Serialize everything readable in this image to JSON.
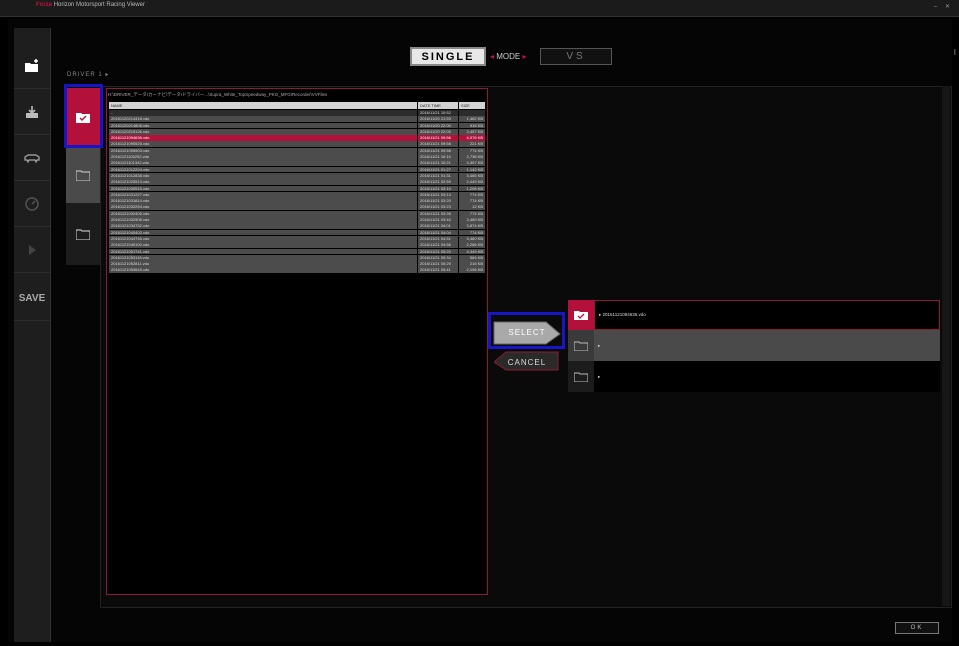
{
  "window": {
    "title_brand": "Forza",
    "title_rest": "Horizon Motorsport Racing",
    "title_app": "Viewer",
    "window_controls": "– ✕"
  },
  "sidebar": {
    "items": [
      {
        "icon": "folder-add-icon"
      },
      {
        "icon": "download-icon"
      },
      {
        "icon": "car-icon"
      },
      {
        "icon": "gauge-icon"
      },
      {
        "icon": "play-icon"
      },
      {
        "icon": "save-icon",
        "label": "SAVE"
      }
    ]
  },
  "mode": {
    "single_label": "SINGLE",
    "mode_label": "MODE",
    "vs_label": "VS",
    "edge_mark": "I"
  },
  "driver": {
    "label": "DRIVER 1 ▸"
  },
  "file_browser": {
    "path": "H:\\DRIVER_データ\\カーナビ\\データ\\ドライバー...\\Supra_White_TopSpeedway_PKG_MFG\\Recorder\\VVFiles",
    "columns": [
      "NAME",
      "DATE TIME",
      "SIZE"
    ],
    "rows": [
      {
        "name": "..",
        "date": "2016/11/21 10:52",
        "size": "",
        "top": true
      },
      {
        "name": "20161120214418.vdo",
        "date": "2016/11/20 21:53",
        "size": "1,462 KB"
      },
      {
        "name": "20161120214808.vdo",
        "date": "2016/11/20 22:00",
        "size": "916 KB"
      },
      {
        "name": "20161120215126.vdo",
        "date": "2016/11/20 22:05",
        "size": "3,457 KB"
      },
      {
        "name": "20161121094636.vdo",
        "date": "2016/11/21 09:56",
        "size": "4,076 KB",
        "selected": true
      },
      {
        "name": "20161121095525.vdo",
        "date": "2016/11/21 09:58",
        "size": "221 KB"
      },
      {
        "name": "20161121095903.vdo",
        "date": "2016/11/21 09:58",
        "size": "774 KB"
      },
      {
        "name": "20161121100252.vdo",
        "date": "2016/11/21 10:10",
        "size": "2,738 KB"
      },
      {
        "name": "20161121101342.vdo",
        "date": "2016/11/21 10:21",
        "size": "4,307 KB"
      },
      {
        "name": "20161121012204.vdo",
        "date": "2016/11/21 01:27",
        "size": "1,142 KB"
      },
      {
        "name": "20161121012838.vdo",
        "date": "2016/11/21 01:31",
        "size": "3,466 KB"
      },
      {
        "name": "20161121025513.vdo",
        "date": "2016/11/21 02:59",
        "size": "2,449 KB"
      },
      {
        "name": "20161121030515.vdo",
        "date": "2016/11/21 03:10",
        "size": "1,208 KB"
      },
      {
        "name": "20161121031227.vdo",
        "date": "2016/11/21 03:14",
        "size": "774 KB"
      },
      {
        "name": "20161121031814.vdo",
        "date": "2016/11/21 03:20",
        "size": "774 KB"
      },
      {
        "name": "20161121032254.vdo",
        "date": "2016/11/21 03:23",
        "size": "12 KB"
      },
      {
        "name": "20161121032405.vdo",
        "date": "2016/11/21 03:26",
        "size": "774 KB"
      },
      {
        "name": "20161121032908.vdo",
        "date": "2016/11/21 03:40",
        "size": "3,489 KB"
      },
      {
        "name": "20161121034752.vdo",
        "date": "2016/11/21 04:01",
        "size": "3,874 KB"
      },
      {
        "name": "20161121040402.vdo",
        "date": "2016/11/21 04:04",
        "size": "774 KB"
      },
      {
        "name": "20161121044746.vdo",
        "date": "2016/11/21 04:51",
        "size": "3,460 KB"
      },
      {
        "name": "20161121045100.vdo",
        "date": "2016/11/21 04:56",
        "size": "2,266 KB"
      },
      {
        "name": "20161121051741.vdo",
        "date": "2016/11/21 05:20",
        "size": "4,349 KB"
      },
      {
        "name": "20161121053118.vdo",
        "date": "2016/11/21 05:34",
        "size": "564 KB"
      },
      {
        "name": "20161121052811.vdo",
        "date": "2016/11/21 05:29",
        "size": "216 KB"
      },
      {
        "name": "20161121053645.vdo",
        "date": "2016/11/21 05:41",
        "size": "2,196 KB"
      }
    ]
  },
  "actions": {
    "select_label": "SELECT",
    "cancel_label": "CANCEL",
    "ok_label": "OK"
  },
  "destinations": [
    {
      "marker": "▸",
      "file": "20161121094636.vdo",
      "state": "filled"
    },
    {
      "marker": "▸",
      "file": "",
      "state": "empty"
    },
    {
      "marker": "▸",
      "file": "",
      "state": "empty"
    }
  ],
  "colors": {
    "accent": "#b3103c",
    "highlight_box": "#1616c8"
  }
}
